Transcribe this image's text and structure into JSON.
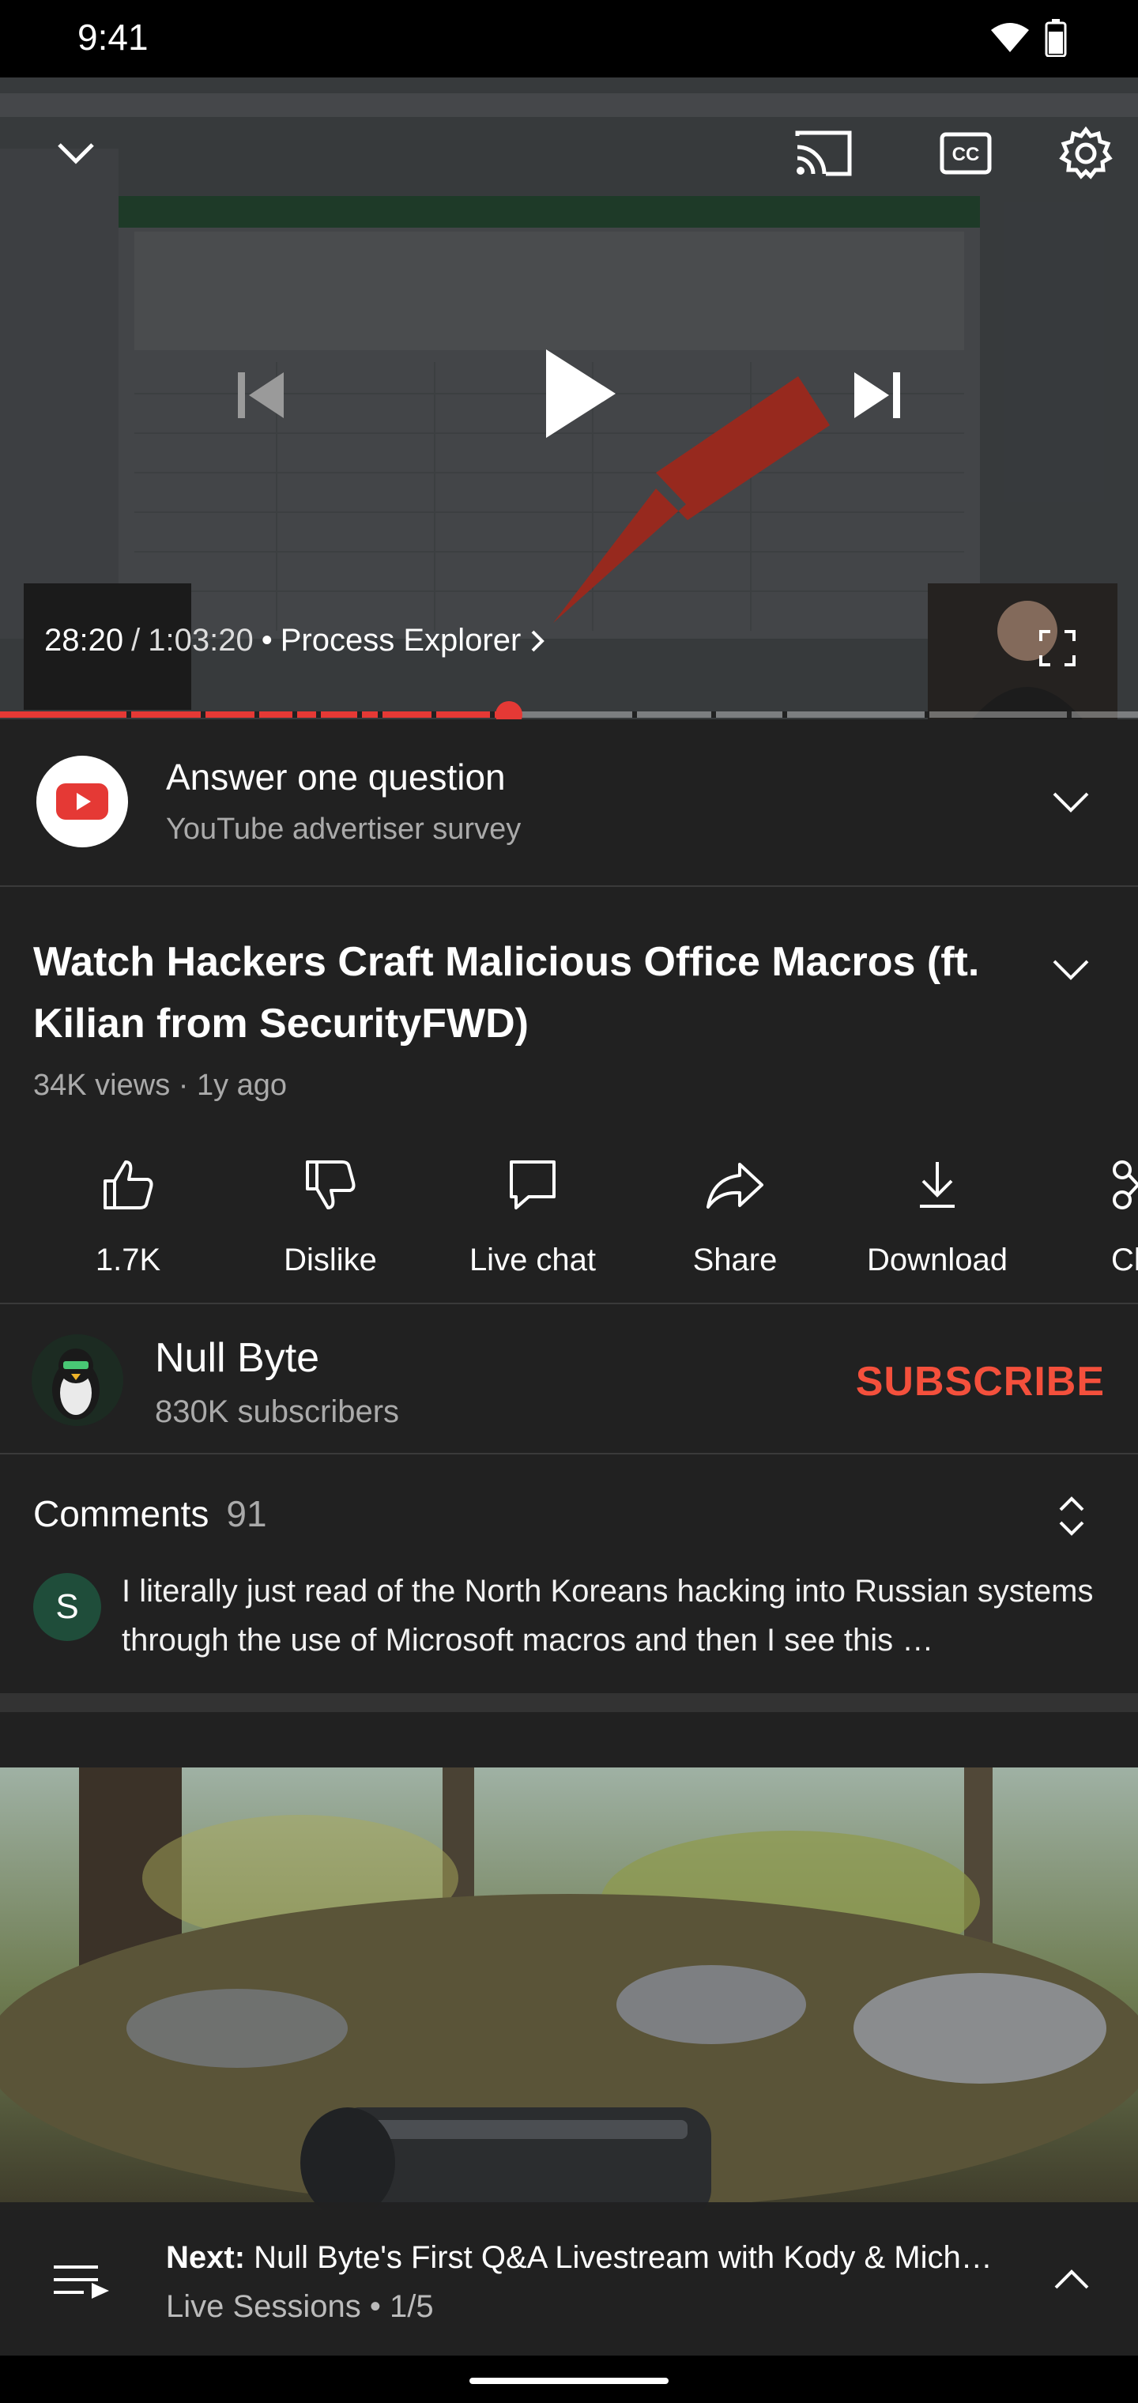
{
  "status_bar": {
    "time": "9:41"
  },
  "player": {
    "current_time": "28:20",
    "duration": "1:03:20",
    "separator": "/",
    "chapter_dot": "•",
    "chapter": "Process Explorer",
    "progress_fraction": 0.447,
    "icons": {
      "collapse": "chevron-down-icon",
      "cast": "cast-icon",
      "captions": "closed-captions-icon",
      "settings": "gear-icon",
      "previous": "skip-previous-icon",
      "play": "play-icon",
      "next": "skip-next-icon",
      "fullscreen": "fullscreen-icon"
    }
  },
  "survey": {
    "title": "Answer one question",
    "subtitle": "YouTube advertiser survey"
  },
  "video": {
    "title": "Watch Hackers Craft Malicious Office Macros (ft. Kilian from SecurityFWD)",
    "meta": "34K views · 1y ago"
  },
  "actions": [
    {
      "label": "1.7K",
      "icon": "thumbs-up-icon"
    },
    {
      "label": "Dislike",
      "icon": "thumbs-down-icon"
    },
    {
      "label": "Live chat",
      "icon": "live-chat-icon"
    },
    {
      "label": "Share",
      "icon": "share-icon"
    },
    {
      "label": "Download",
      "icon": "download-icon"
    },
    {
      "label": "Cl",
      "icon": "clip-icon"
    }
  ],
  "channel": {
    "name": "Null Byte",
    "subscribers": "830K subscribers",
    "subscribe_label": "SUBSCRIBE"
  },
  "comments": {
    "label": "Comments",
    "count": "91",
    "first_author_initial": "S",
    "first_text": "I literally just read of the North Koreans hacking into Russian systems through the use of Microsoft macros and then I see this …"
  },
  "next": {
    "prefix": "Next:",
    "title": "Null Byte's First Q&A Livestream with Kody & Mich…",
    "playlist": "Live Sessions • 1/5"
  },
  "colors": {
    "accent_red": "#e53935",
    "subscribe_red": "#f4503c",
    "background": "#212121"
  }
}
